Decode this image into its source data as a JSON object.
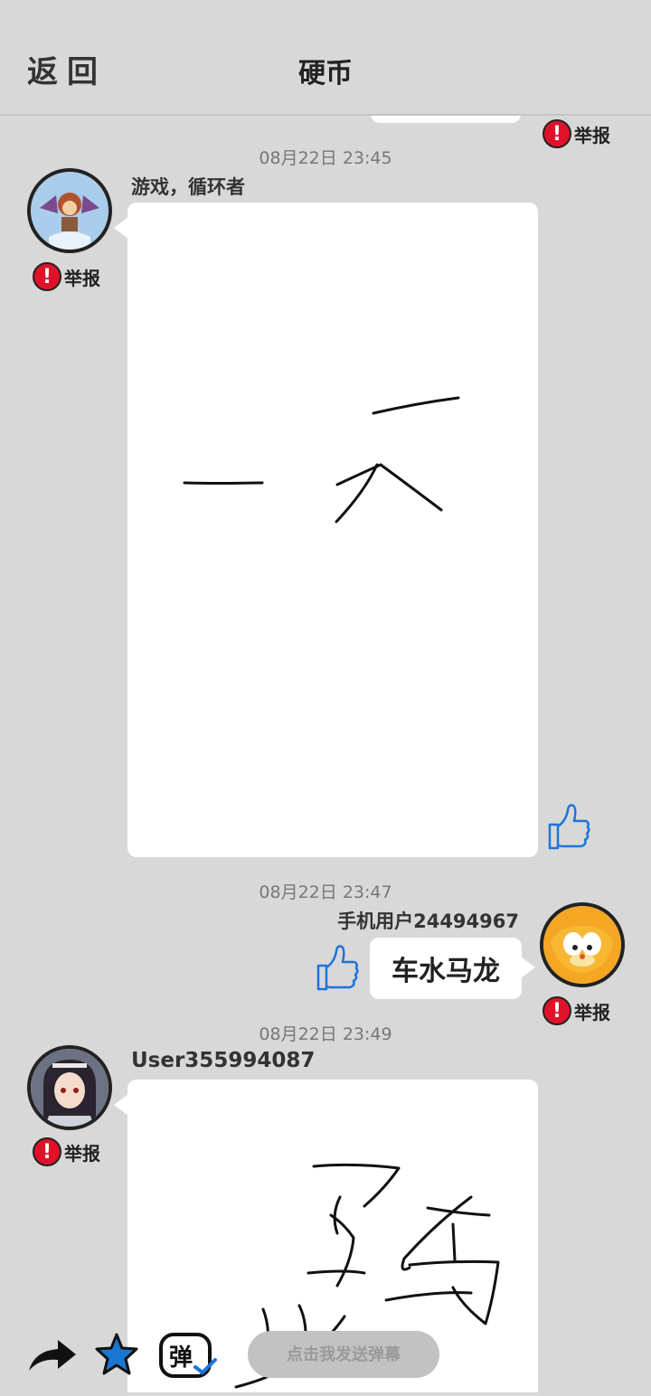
{
  "header": {
    "back_label": "返回",
    "title": "硬币"
  },
  "report_label": "举报",
  "messages": [
    {
      "timestamp": "08月22日  23:45",
      "user": "游戏，循环者",
      "side": "left",
      "type": "drawing"
    },
    {
      "timestamp": "08月22日  23:47",
      "user": "手机用户24494967",
      "side": "right",
      "type": "text",
      "text": "车水马龙"
    },
    {
      "timestamp": "08月22日  23:49",
      "user": "User355994087",
      "side": "left",
      "type": "drawing"
    }
  ],
  "bottom_bar": {
    "danmu_icon_label": "弹",
    "input_placeholder": "点击我发送弹幕"
  },
  "colors": {
    "background": "#d8d8d8",
    "report_red": "#e0122a",
    "like_blue": "#1d74d8",
    "star_blue": "#1976d2"
  }
}
